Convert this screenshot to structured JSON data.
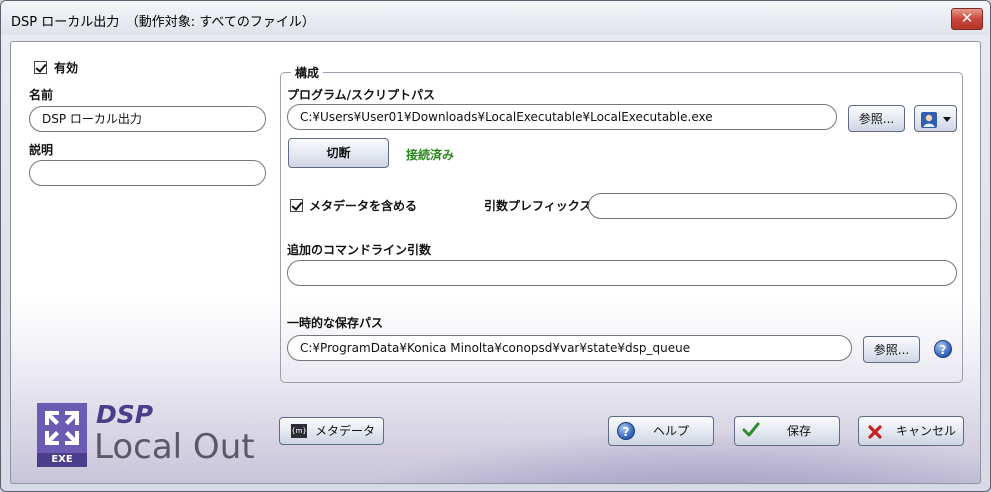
{
  "window": {
    "title": "DSP ローカル出力　（動作対象: すべてのファイル）",
    "close_glyph": "✕"
  },
  "left": {
    "enabled_label": "有効",
    "enabled_checked": true,
    "name_label": "名前",
    "name_value": "DSP ローカル出力",
    "description_label": "説明",
    "description_value": ""
  },
  "config": {
    "group_title": "構成",
    "program_path_label": "プログラム/スクリプトパス",
    "program_path_value": "C:¥Users¥User01¥Downloads¥LocalExecutable¥LocalExecutable.exe",
    "browse_label": "参照...",
    "disconnect_label": "切断",
    "status_text": "接続済み",
    "include_metadata_label": "メタデータを含める",
    "include_metadata_checked": true,
    "arg_prefix_label": "引数プレフィックス",
    "arg_prefix_value": "",
    "extra_cmdline_label": "追加のコマンドライン引数",
    "extra_cmdline_value": "",
    "temp_path_label": "一時的な保存パス",
    "temp_path_value": "C:¥ProgramData¥Konica Minolta¥conopsd¥var¥state¥dsp_queue",
    "temp_browse_label": "参照..."
  },
  "logo": {
    "line1": "DSP",
    "line2": "Local Out",
    "badge_text": "EXE"
  },
  "footer": {
    "metadata_button": "メタデータ",
    "metadata_icon_text": "{m}",
    "help_button": "ヘルプ",
    "save_button": "保存",
    "cancel_button": "キャンセル"
  },
  "colors": {
    "accent_purple": "#5b4a9a",
    "status_green": "#2b8a1f",
    "close_red": "#c9473a"
  }
}
